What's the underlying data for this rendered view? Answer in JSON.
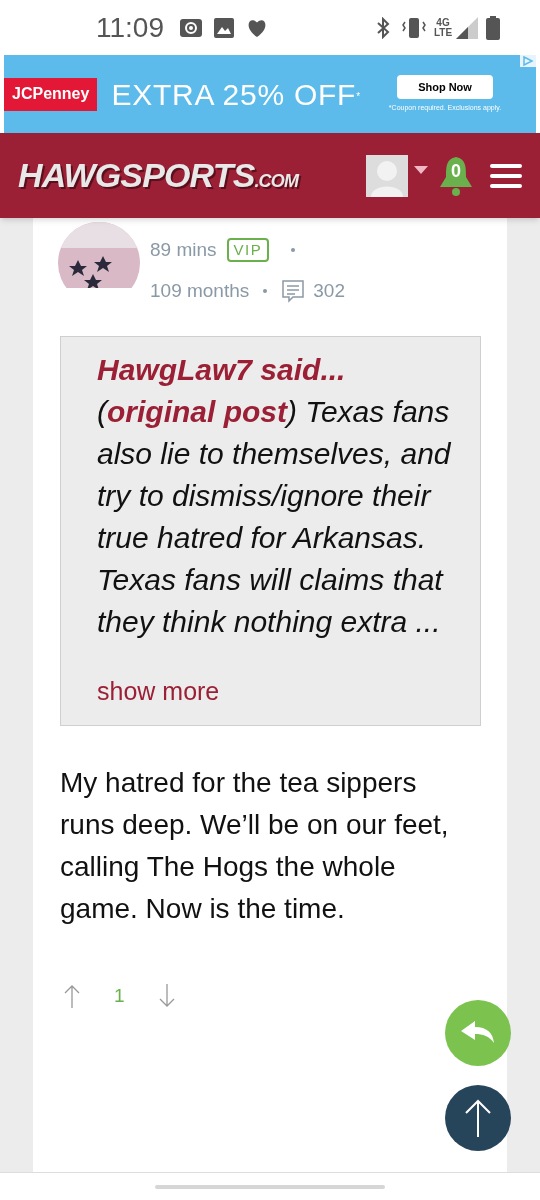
{
  "status_bar": {
    "time": "11:09",
    "network": "4G LTE"
  },
  "ad": {
    "brand": "JCPenney",
    "headline": "EXTRA 25% OFF",
    "mark": "*",
    "button": "Shop Now",
    "fine_print": "*Coupon required. Exclusions apply."
  },
  "header": {
    "logo_main": "HAWGSPORTS",
    "logo_suffix": ".COM",
    "notifications": "0"
  },
  "post": {
    "age": "89 mins",
    "badge": "VIP",
    "tenure": "109 months",
    "comment_count": "302",
    "quote": {
      "author": "HawgLaw7 said...",
      "text": "(**original post**) Texas fans also lie to themselves, and try to dismiss/ignore their true hatred for Arkansas. Texas fans will claims that they think nothing extra ...",
      "more": "show more"
    },
    "body": "My hatred for the tea sippers runs deep. We’ll be on our feet, calling The Hogs the whole game. Now is the time.",
    "score": "1"
  }
}
